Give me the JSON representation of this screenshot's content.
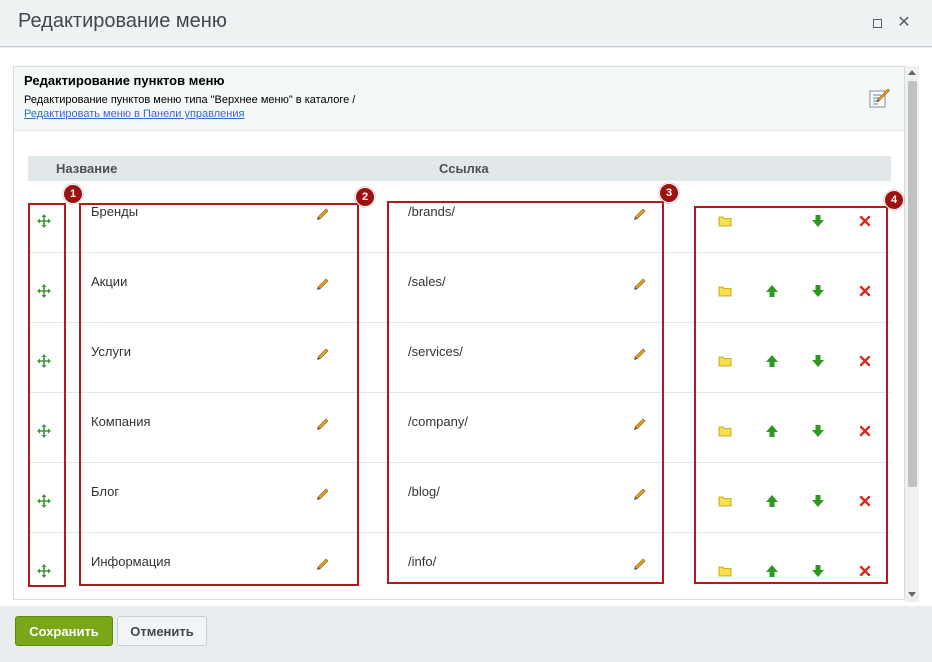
{
  "window": {
    "title": "Редактирование меню",
    "maximize_icon": "maximize-icon",
    "close_icon": "close-icon"
  },
  "header": {
    "title": "Редактирование пунктов меню",
    "description": "Редактирование пунктов меню типа \"Верхнее меню\" в каталоге /",
    "link": "Редактировать меню в Панели управления",
    "icon": "edit-menu-icon"
  },
  "table": {
    "columns": [
      "Название",
      "Ссылка"
    ],
    "rows": [
      {
        "name": "Бренды",
        "link": "/brands/"
      },
      {
        "name": "Акции",
        "link": "/sales/"
      },
      {
        "name": "Услуги",
        "link": "/services/"
      },
      {
        "name": "Компания",
        "link": "/company/"
      },
      {
        "name": "Блог",
        "link": "/blog/"
      },
      {
        "name": "Информация",
        "link": "/info/"
      }
    ]
  },
  "annotations": [
    "1",
    "2",
    "3",
    "4"
  ],
  "icons": {
    "move": "move-icon",
    "edit": "pencil-icon",
    "folder": "folder-icon",
    "up": "arrow-up-icon",
    "down": "arrow-down-icon",
    "delete": "delete-icon"
  },
  "colors": {
    "accent_green": "#78a717",
    "annotation_red": "#b41a1a",
    "link_blue": "#2c6ecb"
  },
  "footer": {
    "save_label": "Сохранить",
    "cancel_label": "Отменить"
  }
}
